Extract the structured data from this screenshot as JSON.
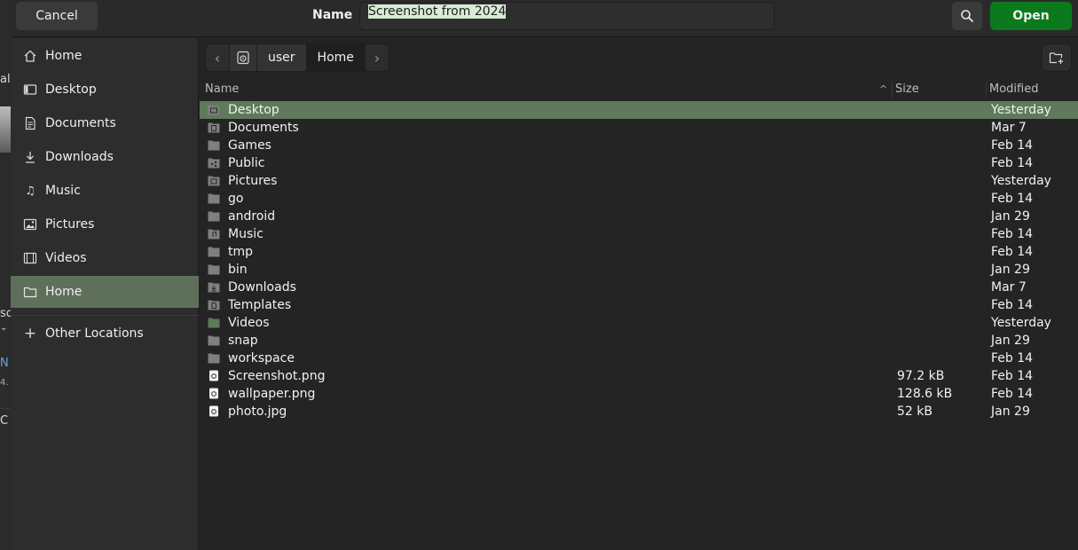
{
  "background_app": {
    "fragments": [
      "al",
      "sc",
      "N",
      "4.",
      "C"
    ]
  },
  "header": {
    "cancel_label": "Cancel",
    "title": "Name",
    "filename_value": "Screenshot from 2024",
    "open_label": "Open",
    "search_icon": "search-icon"
  },
  "sidebar": {
    "items": [
      {
        "label": "Home",
        "icon": "home-icon"
      },
      {
        "label": "Desktop",
        "icon": "desktop-icon"
      },
      {
        "label": "Documents",
        "icon": "documents-icon"
      },
      {
        "label": "Downloads",
        "icon": "downloads-icon"
      },
      {
        "label": "Music",
        "icon": "music-icon"
      },
      {
        "label": "Pictures",
        "icon": "pictures-icon"
      },
      {
        "label": "Videos",
        "icon": "videos-icon"
      },
      {
        "label": "Home",
        "icon": "folder-icon"
      },
      {
        "label": "Other Locations",
        "icon": "plus-icon"
      }
    ]
  },
  "pathbar": {
    "crumbs": [
      "user",
      "Home"
    ],
    "disk_icon": "disk-icon",
    "back_icon": "chevron-left-icon",
    "forward_icon": "chevron-right-icon",
    "new_folder_icon": "new-folder-icon"
  },
  "list": {
    "columns": {
      "name": "Name",
      "size": "Size",
      "modified": "Modified"
    },
    "rows": [
      {
        "name": "Desktop",
        "size": "",
        "modified": "Yesterday",
        "icon": "desktop-folder-icon"
      },
      {
        "name": "Documents",
        "size": "",
        "modified": "Mar 7",
        "icon": "documents-folder-icon"
      },
      {
        "name": "Games",
        "size": "",
        "modified": "Feb 14",
        "icon": "folder-icon"
      },
      {
        "name": "Public",
        "size": "",
        "modified": "Feb 14",
        "icon": "public-folder-icon"
      },
      {
        "name": "Pictures",
        "size": "",
        "modified": "Yesterday",
        "icon": "pictures-folder-icon"
      },
      {
        "name": "go",
        "size": "",
        "modified": "Feb 14",
        "icon": "folder-icon"
      },
      {
        "name": "android",
        "size": "",
        "modified": "Jan 29",
        "icon": "folder-icon"
      },
      {
        "name": "Music",
        "size": "",
        "modified": "Feb 14",
        "icon": "music-folder-icon"
      },
      {
        "name": "tmp",
        "size": "",
        "modified": "Feb 14",
        "icon": "folder-icon"
      },
      {
        "name": "bin",
        "size": "",
        "modified": "Jan 29",
        "icon": "folder-icon"
      },
      {
        "name": "Downloads",
        "size": "",
        "modified": "Mar 7",
        "icon": "downloads-folder-icon"
      },
      {
        "name": "Templates",
        "size": "",
        "modified": "Feb 14",
        "icon": "templates-folder-icon"
      },
      {
        "name": "Videos",
        "size": "",
        "modified": "Yesterday",
        "icon": "videos-folder-icon"
      },
      {
        "name": "snap",
        "size": "",
        "modified": "Jan 29",
        "icon": "folder-icon"
      },
      {
        "name": "workspace",
        "size": "",
        "modified": "Feb 14",
        "icon": "folder-icon"
      },
      {
        "name": "Screenshot.png",
        "size": "97.2 kB",
        "modified": "Feb 14",
        "icon": "image-file-icon"
      },
      {
        "name": "wallpaper.png",
        "size": "128.6 kB",
        "modified": "Feb 14",
        "icon": "image-file-icon"
      },
      {
        "name": "photo.jpg",
        "size": "52 kB",
        "modified": "Jan 29",
        "icon": "image-file-icon"
      }
    ]
  },
  "colors": {
    "accent_green": "#0b7a1c",
    "selection_green": "#5e7a5a",
    "sidebar_active": "#5e6f5a"
  }
}
